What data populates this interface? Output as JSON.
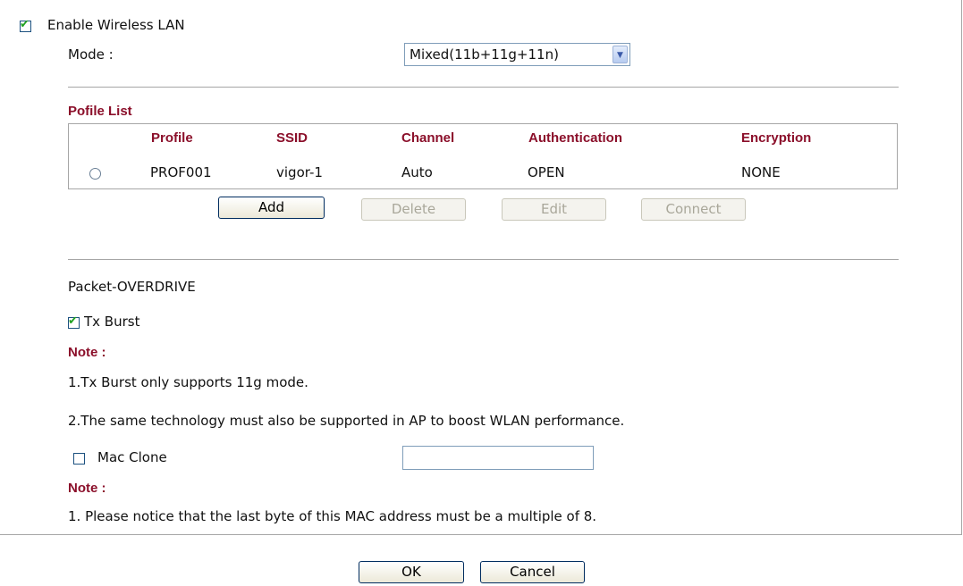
{
  "wireless": {
    "enable_label": "Enable Wireless LAN",
    "enabled": true,
    "mode_label": "Mode :",
    "mode_value": "Mixed(11b+11g+11n)"
  },
  "profile_list": {
    "title": "Pofile List",
    "columns": [
      "Profile",
      "SSID",
      "Channel",
      "Authentication",
      "Encryption"
    ],
    "rows": [
      {
        "profile": "PROF001",
        "ssid": "vigor-1",
        "channel": "Auto",
        "authentication": "OPEN",
        "encryption": "NONE"
      }
    ],
    "buttons": {
      "add": "Add",
      "delete": "Delete",
      "edit": "Edit",
      "connect": "Connect"
    }
  },
  "packet_overdrive": {
    "title": "Packet-OVERDRIVE",
    "tx_burst_label": "Tx Burst",
    "tx_burst_checked": true,
    "note_label": "Note :",
    "notes": [
      "1.Tx Burst only supports 11g mode.",
      "2.The same technology must also be supported in AP to boost WLAN performance."
    ]
  },
  "mac_clone": {
    "label": "Mac Clone",
    "checked": false,
    "value": "",
    "note_label": "Note :",
    "notes": [
      "1. Please notice that the last byte of this MAC address must be a multiple of 8."
    ]
  },
  "footer": {
    "ok": "OK",
    "cancel": "Cancel"
  },
  "colors": {
    "note_red": "#8b0f2a",
    "check_green": "#21a121",
    "border": "#a6a6a6"
  }
}
